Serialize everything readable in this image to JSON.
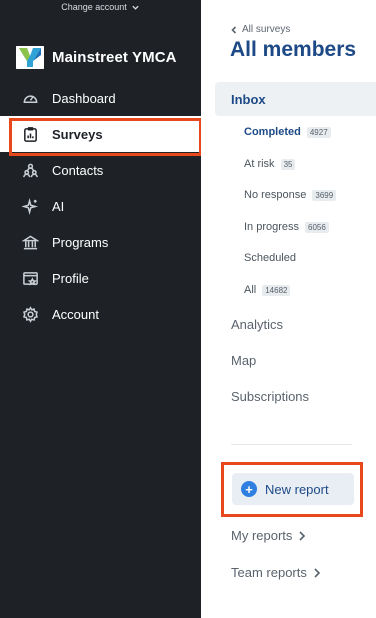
{
  "sidebar": {
    "change_account": "Change account",
    "org_name": "Mainstreet YMCA",
    "items": [
      {
        "label": "Dashboard",
        "icon": "gauge-icon"
      },
      {
        "label": "Surveys",
        "icon": "clipboard-chart-icon"
      },
      {
        "label": "Contacts",
        "icon": "people-icon"
      },
      {
        "label": "AI",
        "icon": "sparkle-icon"
      },
      {
        "label": "Programs",
        "icon": "building-icon"
      },
      {
        "label": "Profile",
        "icon": "profile-card-icon"
      },
      {
        "label": "Account",
        "icon": "gear-icon"
      }
    ],
    "active_item": "Surveys"
  },
  "panel": {
    "back_link": "All surveys",
    "title": "All members",
    "inbox": "Inbox",
    "filters": [
      {
        "label": "Completed",
        "count": "4927"
      },
      {
        "label": "At risk",
        "count": "35"
      },
      {
        "label": "No response",
        "count": "3699"
      },
      {
        "label": "In progress",
        "count": "6056"
      },
      {
        "label": "Scheduled",
        "count": ""
      },
      {
        "label": "All",
        "count": "14682"
      }
    ],
    "sections": {
      "analytics": "Analytics",
      "map": "Map",
      "subscriptions": "Subscriptions"
    },
    "new_report": "New report",
    "my_reports": "My reports",
    "team_reports": "Team reports"
  },
  "colors": {
    "sidebar_bg": "#1e2227",
    "highlight": "#e8491c",
    "title": "#1d4a86",
    "plus_icon": "#2f7fe0"
  }
}
